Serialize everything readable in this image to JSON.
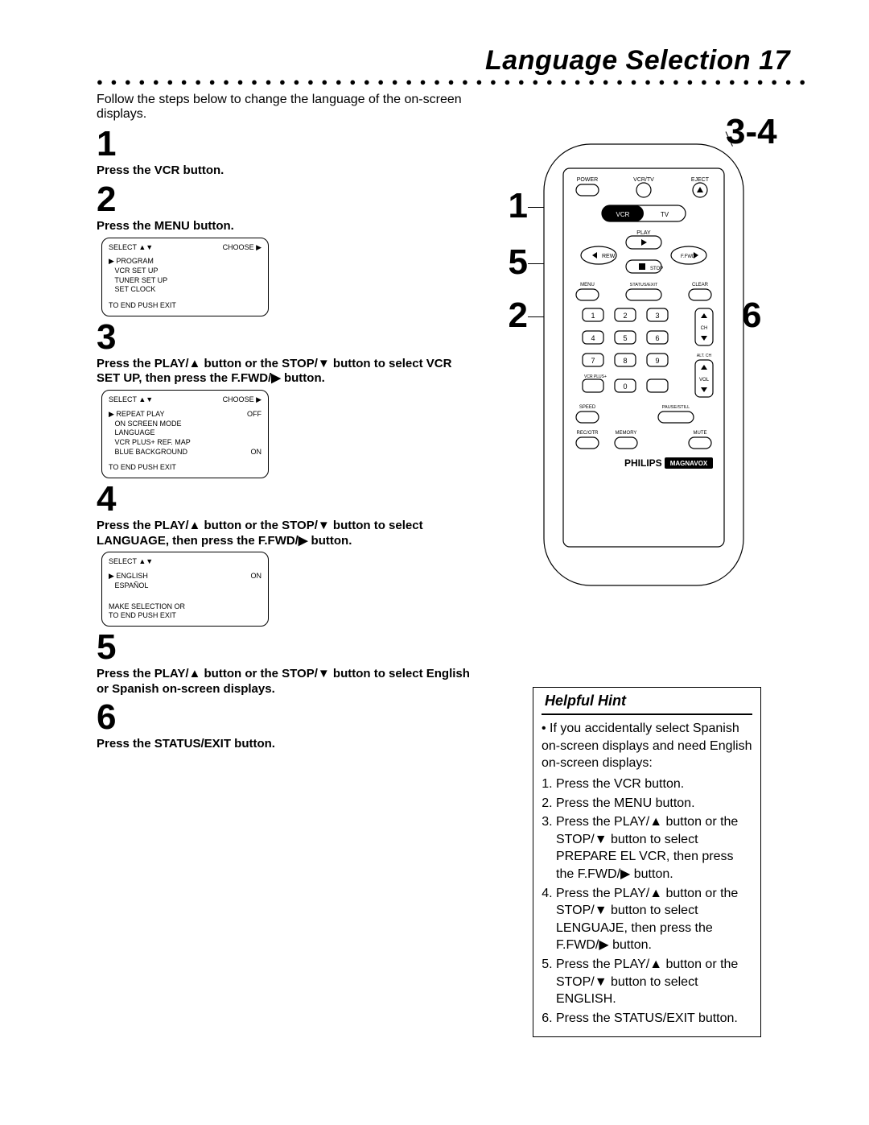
{
  "header": {
    "title": "Language Selection",
    "page_no": "17"
  },
  "intro": "Follow the steps below to change the language of the on-screen displays.",
  "steps": {
    "1": {
      "num": "1",
      "text": "Press the VCR button."
    },
    "2": {
      "num": "2",
      "text": "Press the MENU button."
    },
    "3": {
      "num": "3",
      "text": "Press the PLAY/▲ button or the STOP/▼ button to select VCR SET UP, then press the F.FWD/▶ button."
    },
    "4": {
      "num": "4",
      "text": "Press the PLAY/▲ button or the STOP/▼ button to select LANGUAGE, then press the F.FWD/▶ button."
    },
    "5": {
      "num": "5",
      "text": "Press the PLAY/▲ button or the STOP/▼ button to select English or Spanish on-screen displays."
    },
    "6": {
      "num": "6",
      "text": "Press the STATUS/EXIT button."
    }
  },
  "osd1": {
    "headL": "SELECT ▲▼",
    "headR": "CHOOSE ▶",
    "l1": "▶ PROGRAM",
    "l2": "   VCR SET UP",
    "l3": "   TUNER SET UP",
    "l4": "   SET CLOCK",
    "foot": "TO END PUSH EXIT"
  },
  "osd2": {
    "headL": "SELECT ▲▼",
    "headR": "CHOOSE ▶",
    "r1L": "▶ REPEAT PLAY",
    "r1R": "OFF",
    "r2": "   ON SCREEN MODE",
    "r3": "   LANGUAGE",
    "r4": "   VCR PLUS+ REF. MAP",
    "r5L": "   BLUE BACKGROUND",
    "r5R": "ON",
    "foot": "TO END PUSH EXIT"
  },
  "osd3": {
    "head": "SELECT ▲▼",
    "r1L": "▶ ENGLISH",
    "r1R": "ON",
    "r2": "   ESPAÑOL",
    "f1": "MAKE SELECTION OR",
    "f2": "TO END PUSH EXIT"
  },
  "callouts": {
    "c1": "1",
    "c2": "2",
    "c34": "3-4",
    "c5": "5",
    "c6": "6"
  },
  "remote": {
    "row1": {
      "power": "POWER",
      "vcrtv": "VCR/TV",
      "eject": "EJECT"
    },
    "tabs": {
      "vcr": "VCR",
      "tv": "TV"
    },
    "transport": {
      "play": "PLAY",
      "rew": "REW",
      "ffwd": "F.FWD",
      "stop": "STOP"
    },
    "mid": {
      "menu": "MENU",
      "status": "STATUS/EXIT",
      "clear": "CLEAR"
    },
    "side": {
      "ch": "CH",
      "vol": "VOL",
      "altch": "ALT. CH"
    },
    "numpad": {
      "n1": "1",
      "n2": "2",
      "n3": "3",
      "n4": "4",
      "n5": "5",
      "n6": "6",
      "n7": "7",
      "n8": "8",
      "n9": "9",
      "n0": "0",
      "vcrplus": "VCR PLUS+"
    },
    "bot": {
      "speed": "SPEED",
      "pause": "PAUSE/STILL"
    },
    "bot2": {
      "rec": "REC/OTR",
      "mem": "MEMORY",
      "mute": "MUTE"
    },
    "brand": {
      "philips": "PHILIPS",
      "magnavox": "MAGNAVOX"
    }
  },
  "hint": {
    "title": "Helpful Hint",
    "lead": "• If you accidentally select Spanish on-screen displays and need English on-screen displays:",
    "s1": "Press the VCR button.",
    "s2": "Press the MENU button.",
    "s3": "Press the PLAY/▲ button or the STOP/▼ button to select PREPARE EL VCR, then press the F.FWD/▶ button.",
    "s4": "Press the PLAY/▲ button or the STOP/▼ button to select LENGUAJE, then press the F.FWD/▶ button.",
    "s5": "Press the PLAY/▲ button or the STOP/▼ button to select ENGLISH.",
    "s6": "Press the STATUS/EXIT button."
  }
}
